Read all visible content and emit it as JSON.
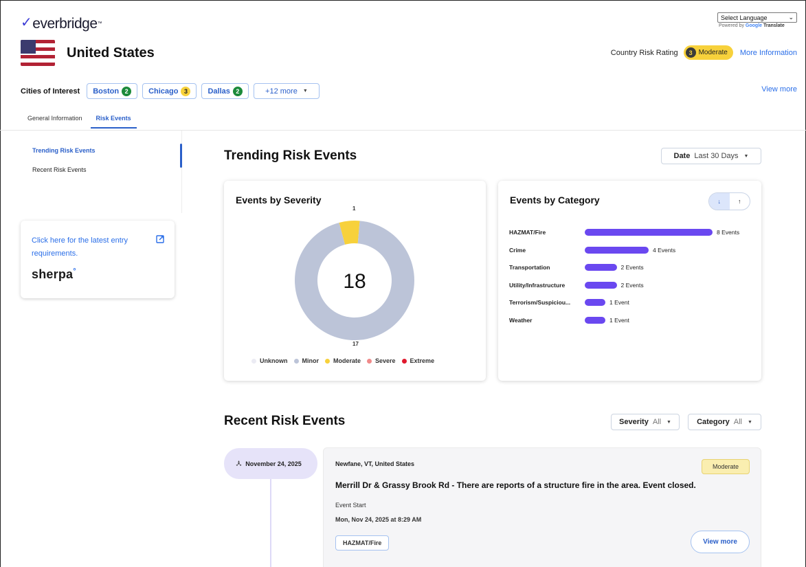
{
  "header": {
    "logo_text": "everbridge",
    "language_select": "Select Language",
    "powered_by": "Powered by",
    "google": "Google",
    "translate": "Translate"
  },
  "country": {
    "name": "United States",
    "risk_label": "Country Risk Rating",
    "risk_level_number": "3",
    "risk_level": "Moderate",
    "more_info": "More Information"
  },
  "cities": {
    "label": "Cities of Interest",
    "items": [
      {
        "name": "Boston",
        "count": "2",
        "color": "#1c8a3a"
      },
      {
        "name": "Chicago",
        "count": "3",
        "color": "#f7d13b"
      },
      {
        "name": "Dallas",
        "count": "2",
        "color": "#1c8a3a"
      }
    ],
    "more_label": "+12 more",
    "view_more": "View more"
  },
  "tabs": [
    {
      "label": "General Information",
      "active": false
    },
    {
      "label": "Risk Events",
      "active": true
    }
  ],
  "sidebar": {
    "items": [
      {
        "label": "Trending Risk Events",
        "active": true
      },
      {
        "label": "Recent Risk Events",
        "active": false
      }
    ],
    "sherpa_link": "Click here for the latest entry requirements.",
    "sherpa_logo": "sherpa",
    "sherpa_logo_mark": "°"
  },
  "trending": {
    "title": "Trending Risk Events",
    "date_label": "Date",
    "date_value": "Last 30 Days"
  },
  "severity_chart": {
    "title": "Events by Severity",
    "total": "18",
    "label_small": "1",
    "label_large": "17",
    "legend": [
      {
        "label": "Unknown",
        "color": "#ebebf3"
      },
      {
        "label": "Minor",
        "color": "#bcc4d8"
      },
      {
        "label": "Moderate",
        "color": "#f7d13b"
      },
      {
        "label": "Severe",
        "color": "#f08a8a"
      },
      {
        "label": "Extreme",
        "color": "#e0192d"
      }
    ]
  },
  "category_chart": {
    "title": "Events by Category",
    "sort_desc": "↓",
    "sort_asc": "↑"
  },
  "chart_data": [
    {
      "type": "pie",
      "title": "Events by Severity",
      "categories": [
        "Unknown",
        "Minor",
        "Moderate",
        "Severe",
        "Extreme"
      ],
      "values": [
        0,
        17,
        1,
        0,
        0
      ]
    },
    {
      "type": "bar",
      "title": "Events by Category",
      "categories": [
        "HAZMAT/Fire",
        "Crime",
        "Transportation",
        "Utility/Infrastructure",
        "Terrorism/Suspiciou...",
        "Weather"
      ],
      "values": [
        8,
        4,
        2,
        2,
        1,
        1
      ],
      "labels": [
        "8 Events",
        "4 Events",
        "2 Events",
        "2 Events",
        "1 Event",
        "1 Event"
      ],
      "xlim": [
        0,
        8
      ]
    }
  ],
  "recent": {
    "title": "Recent Risk Events",
    "severity_label": "Severity",
    "severity_value": "All",
    "category_label": "Category",
    "category_value": "All",
    "event": {
      "date": "November 24, 2025",
      "location": "Newfane, VT, United States",
      "severity": "Moderate",
      "title": "Merrill Dr & Grassy Brook Rd - There are reports of a structure fire in the area. Event closed.",
      "start_label": "Event Start",
      "start_value": "Mon, Nov 24, 2025 at 8:29 AM",
      "tag": "HAZMAT/Fire",
      "view_more": "View more"
    }
  }
}
